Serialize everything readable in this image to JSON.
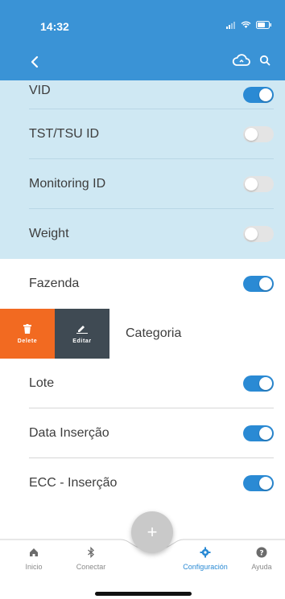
{
  "status_bar": {
    "time": "14:32"
  },
  "nav": {
    "back_icon": "chevron-left-icon",
    "cloud_icon": "cloud-sync-icon",
    "search_icon": "search-icon"
  },
  "rows": [
    {
      "label": "VID",
      "enabled": true
    },
    {
      "label": "TST/TSU ID",
      "enabled": false
    },
    {
      "label": "Monitoring ID",
      "enabled": false
    },
    {
      "label": "Weight",
      "enabled": false
    },
    {
      "label": "Fazenda",
      "enabled": true
    },
    {
      "label": "Categoria"
    },
    {
      "label": "Lote",
      "enabled": true
    },
    {
      "label": "Data Inserção",
      "enabled": true
    },
    {
      "label": "ECC - Inserção",
      "enabled": true
    }
  ],
  "swipe_actions": {
    "delete_label": "Delete",
    "edit_label": "Editar"
  },
  "tabs": [
    {
      "label": "Inicio",
      "icon": "home-icon"
    },
    {
      "label": "Conectar",
      "icon": "bluetooth-icon"
    },
    {
      "label": "Configuración",
      "icon": "gear-icon"
    },
    {
      "label": "Ayuda",
      "icon": "help-icon"
    }
  ],
  "fab": {
    "label": "+"
  },
  "colors": {
    "header": "#3a93d6",
    "accent": "#2a8ad4",
    "delete": "#f26a21",
    "edit": "#3f4a53",
    "shaded_row": "#cfe8f3"
  }
}
